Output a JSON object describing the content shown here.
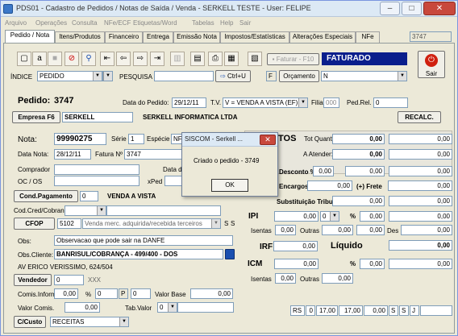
{
  "window": {
    "title": "PDS01 - Cadastro de Pedidos / Notas de Saída / Venda - SERKELL TESTE - User: FELIPE",
    "minimize": "–",
    "maximize": "□",
    "close": "✕"
  },
  "menu": [
    "Arquivo",
    "Operações",
    "Consulta",
    "NFe/ECF",
    "Etiquetas/Word",
    "Tabelas",
    "Help",
    "Sair"
  ],
  "tabs": [
    "Pedido / Nota",
    "Itens/Produtos",
    "Financeiro",
    "Entrega",
    "Emissão Nota",
    "Impostos/Estatísticas",
    "Alterações Especiais",
    "NFe"
  ],
  "tab_number": "3747",
  "toolbar": {
    "faturar_label": "Faturar - F10",
    "status_banner": "FATURADO",
    "sair_label": "Sair"
  },
  "search_row": {
    "indice_label": "ÍNDICE",
    "indice_value": "PEDIDO",
    "pesquisa_label": "PESQUISA",
    "ctrlu_label": "Ctrl+U",
    "f_box": "F",
    "orcamento_label": "Orçamento",
    "n_value": "N"
  },
  "pedido": {
    "label": "Pedido:",
    "number": "3747",
    "data_label": "Data do Pedido:",
    "data_value": "29/12/11",
    "tv_label": "T.V.",
    "tv_value": "V = VENDA A VISTA (EF)",
    "filial_label": "Filial",
    "filial_value": "000",
    "pedrel_label": "Ped.Rel.",
    "pedrel_value": "0"
  },
  "empresa": {
    "button": "Empresa F6",
    "value": "SERKELL",
    "name": "SERKELL INFORMATICA LTDA",
    "recalc_button": "RECALC."
  },
  "nota": {
    "label": "Nota:",
    "number": "99990275",
    "serie_label": "Série",
    "serie_value": "1",
    "especie_label": "Espécie",
    "especie_value": "NF",
    "data_nota_label": "Data Nota:",
    "data_nota_value": "28/12/11",
    "fatura_label": "Fatura Nº",
    "fatura_value": "3747",
    "comprador_label": "Comprador",
    "datade_label": "Data de",
    "oc_label": "OC / OS",
    "xped_label": "xPed"
  },
  "cond_pag": {
    "button": "Cond.Pagamento",
    "value": "0",
    "text": "VENDA A VISTA",
    "cred_label": "Cod.Cred/Cobrança"
  },
  "cfop": {
    "button": "CFOP",
    "value": "5102",
    "desc": "Venda merc. adquirida/recebida terceiros",
    "flag1": "S",
    "flag2": "S"
  },
  "obs": {
    "label": "Obs:",
    "value": "Observacao que pode sair na DANFE",
    "cliente_label": "Obs.Cliente:",
    "cliente_line1": "BANRISUL/COBRANÇA - 499/400 - DOS",
    "cliente_line2": "AV ERICO VERISSIMO, 624/504"
  },
  "vendedor": {
    "button": "Vendedor",
    "value": "0",
    "mark": "XXX"
  },
  "comis": {
    "inform_label": "Comis.Inform.",
    "inform_value": "0,00",
    "pct": "%",
    "zero": "0",
    "p_box": "P",
    "p_value": "0",
    "valor_base_label": "Valor Base",
    "valor_base_value": "0,00",
    "valor_comis_label": "Valor Comis.",
    "valor_comis_value": "0,00",
    "tab_valor_label": "Tab.Valor",
    "tab_valor_value": "0"
  },
  "custo": {
    "button": "C/Custo",
    "value": "RECEITAS"
  },
  "totals": {
    "tos": "TOS",
    "tot_quant_label": "Tot Quant:",
    "tot_quant_value": "0,00",
    "atender_label": "A Atender:",
    "atender_value": "0,00",
    "desconto_label": "Desconto %",
    "desconto_pct": "0,00",
    "desconto_value": "0,00",
    "encargos_label": "Encargos",
    "encargos_value": "0,00",
    "frete_label": "(+) Frete",
    "frete_value": "0,00",
    "substituicao_label": "Substituição Tributária",
    "ipi_label": "IPI",
    "ipi_value": "0,00",
    "ipi_code": "0",
    "ipi_pct": "%",
    "ipi_pct_value": "0,00",
    "isentas_label": "Isentas",
    "isentas_value": "0,00",
    "outras_label": "Outras",
    "outras_value": "0,00",
    "des_label": "Des",
    "irf_label": "IRF",
    "irf_value": "0,00",
    "liquido_label": "Líquido",
    "liquido_value": "0,00",
    "icm_label": "ICM",
    "icm_value": "0,00",
    "icm_pct": "%",
    "icm_pct_value": "0,00",
    "icm_isentas_label": "Isentas",
    "icm_isentas_value": "0,00",
    "icm_outras_label": "Outras",
    "icm_outras_value": "0,00",
    "right_values": [
      "0,00",
      "0,00",
      "0,00",
      "0,00",
      "0,00",
      "0,00",
      "0,00",
      "0,00",
      "0,00"
    ]
  },
  "statusbar": [
    "RS",
    "0",
    "17,00",
    "17,00",
    "0,00",
    "S",
    "S",
    "J"
  ],
  "dialog": {
    "title": "SISCOM - Serkell ...",
    "close": "✕",
    "message": "Criado o pedido - 3749",
    "ok": "OK"
  },
  "colors": {
    "banner_bg": "#0a1e8c",
    "banner_fg": "#ffffff",
    "sair_red": "#d02010",
    "input_border": "#7f9db9",
    "window_bg": "#ece9d8"
  }
}
